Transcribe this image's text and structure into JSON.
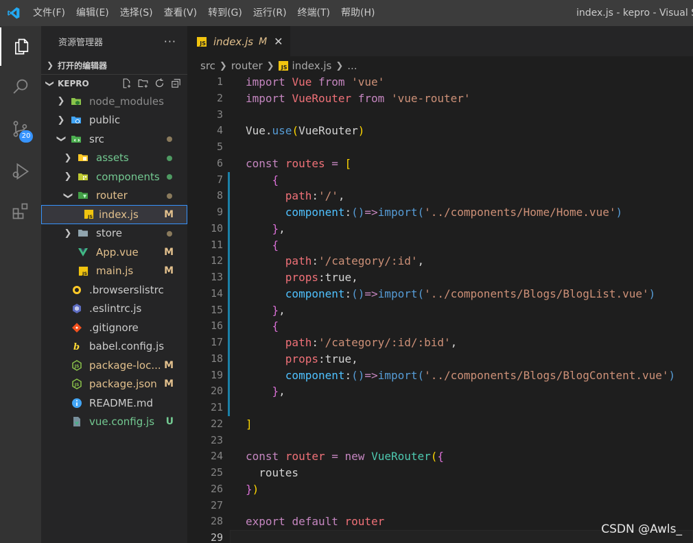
{
  "titlebar": {
    "menu": [
      "文件(F)",
      "编辑(E)",
      "选择(S)",
      "查看(V)",
      "转到(G)",
      "运行(R)",
      "终端(T)",
      "帮助(H)"
    ],
    "window_title": "index.js - kepro - Visual St"
  },
  "activity": {
    "scm_badge": "20"
  },
  "explorer": {
    "title": "资源管理器",
    "more": "···",
    "open_editors": "打开的编辑器",
    "project": "KEPRO",
    "items": [
      {
        "name": "node_modules",
        "type": "folder",
        "icon": "node-folder",
        "color": "#8c8c8c",
        "status": ""
      },
      {
        "name": "public",
        "type": "folder",
        "icon": "globe-folder",
        "color": "#cccccc",
        "status": ""
      },
      {
        "name": "src",
        "type": "folder-open",
        "icon": "src-folder",
        "color": "#cccccc",
        "status": "dot"
      },
      {
        "name": "assets",
        "type": "folder",
        "icon": "assets-folder",
        "color": "#73c991",
        "status": "dot-green"
      },
      {
        "name": "components",
        "type": "folder",
        "icon": "components-folder",
        "color": "#73c991",
        "status": "dot-green"
      },
      {
        "name": "router",
        "type": "folder-open",
        "icon": "router-folder",
        "color": "#e2c08d",
        "status": "dot"
      },
      {
        "name": "index.js",
        "type": "file",
        "icon": "js",
        "color": "#e2c08d",
        "status": "M"
      },
      {
        "name": "store",
        "type": "folder",
        "icon": "store-folder",
        "color": "#cccccc",
        "status": "dot"
      },
      {
        "name": "App.vue",
        "type": "file",
        "icon": "vue",
        "color": "#e2c08d",
        "status": "M"
      },
      {
        "name": "main.js",
        "type": "file",
        "icon": "js",
        "color": "#e2c08d",
        "status": "M"
      },
      {
        "name": ".browserslistrc",
        "type": "file",
        "icon": "browserslist",
        "color": "#cccccc",
        "status": ""
      },
      {
        "name": ".eslintrc.js",
        "type": "file",
        "icon": "eslint",
        "color": "#cccccc",
        "status": ""
      },
      {
        "name": ".gitignore",
        "type": "file",
        "icon": "git",
        "color": "#cccccc",
        "status": ""
      },
      {
        "name": "babel.config.js",
        "type": "file",
        "icon": "babel",
        "color": "#cccccc",
        "status": ""
      },
      {
        "name": "package-loc...",
        "type": "file",
        "icon": "nodejs",
        "color": "#e2c08d",
        "status": "M"
      },
      {
        "name": "package.json",
        "type": "file",
        "icon": "nodejs",
        "color": "#e2c08d",
        "status": "M"
      },
      {
        "name": "README.md",
        "type": "file",
        "icon": "info",
        "color": "#cccccc",
        "status": ""
      },
      {
        "name": "vue.config.js",
        "type": "file",
        "icon": "vue-config",
        "color": "#73c991",
        "status": "U"
      }
    ]
  },
  "editor": {
    "tab": {
      "name": "index.js",
      "modified": "M",
      "close": "✕",
      "badge": "JS"
    },
    "breadcrumb": [
      "src",
      "router",
      "index.js",
      "..."
    ]
  },
  "watermark": "CSDN @Awls_"
}
